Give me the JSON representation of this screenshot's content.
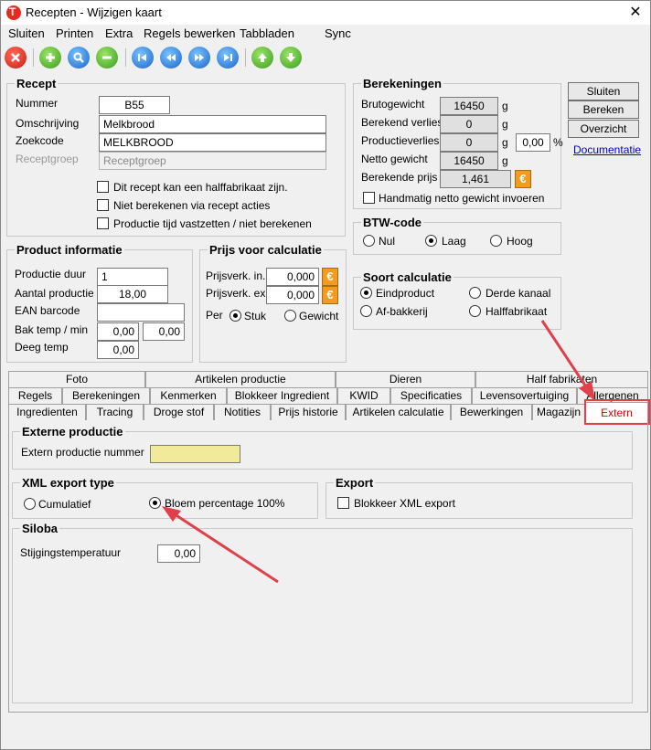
{
  "window": {
    "title": "Recepten - Wijzigen kaart",
    "close_glyph": "✕"
  },
  "menu": [
    "Sluiten",
    "Printen",
    "Extra",
    "Regels bewerken",
    "Tabbladen",
    "Sync"
  ],
  "toolbar": {
    "icons": [
      "close-icon",
      "add-icon",
      "search-icon",
      "remove-icon",
      "first-icon",
      "prev-icon",
      "next-icon",
      "last-icon",
      "up-icon",
      "down-icon"
    ]
  },
  "recept": {
    "title": "Recept",
    "nummer_label": "Nummer",
    "nummer_value": "B55",
    "omschrijving_label": "Omschrijving",
    "omschrijving_value": "Melkbrood",
    "zoekcode_label": "Zoekcode",
    "zoekcode_value": "MELKBROOD",
    "receptgroep_label": "Receptgroep",
    "receptgroep_value": "Receptgroep",
    "chk1": "Dit recept kan een halffabrikaat zijn.",
    "chk2": "Niet berekenen via recept acties",
    "chk3": "Productie tijd vastzetten / niet berekenen"
  },
  "berekeningen": {
    "title": "Berekeningen",
    "brutogewicht_label": "Brutogewicht",
    "brutogewicht_value": "16450",
    "berekend_verlies_label": "Berekend verlies",
    "berekend_verlies_value": "0",
    "productieverlies_label": "Productieverlies",
    "productieverlies_value": "0",
    "productieverlies_pct": "0,00",
    "netto_label": "Netto gewicht",
    "netto_value": "16450",
    "prijs_label": "Berekende prijs",
    "prijs_value": "1,461",
    "unit_g": "g",
    "unit_pct": "%",
    "handmatig": "Handmatig netto gewicht invoeren",
    "euro": "€"
  },
  "buttons": {
    "sluiten": "Sluiten",
    "bereken": "Bereken",
    "overzicht": "Overzicht",
    "documentatie": "Documentatie"
  },
  "btw": {
    "title": "BTW-code",
    "options": [
      "Nul",
      "Laag",
      "Hoog"
    ],
    "selected": "Laag"
  },
  "soort": {
    "title": "Soort calculatie",
    "options": [
      "Eindproduct",
      "Derde kanaal",
      "Af-bakkerij",
      "Halffabrikaat"
    ],
    "selected": "Eindproduct"
  },
  "product": {
    "title": "Product informatie",
    "duur_label": "Productie duur",
    "duur_value": "1",
    "aantal_label": "Aantal productie",
    "aantal_value": "18,00",
    "ean_label": "EAN barcode",
    "ean_value": "",
    "bak_label": "Bak temp / min",
    "bak_temp": "0,00",
    "bak_min": "0,00",
    "deeg_label": "Deeg temp",
    "deeg_value": "0,00"
  },
  "prijs": {
    "title": "Prijs voor calculatie",
    "in_label": "Prijsverk. in.",
    "in_value": "0,000",
    "ex_label": "Prijsverk. ex.",
    "ex_value": "0,000",
    "per_label": "Per",
    "options": [
      "Stuk",
      "Gewicht"
    ],
    "selected": "Stuk"
  },
  "tabs": {
    "row1": [
      "Foto",
      "Artikelen productie",
      "Dieren",
      "Half fabrikaten"
    ],
    "row2": [
      "Regels",
      "Berekeningen",
      "Kenmerken",
      "Blokkeer Ingredient",
      "KWID",
      "Specificaties",
      "Levensovertuiging",
      "Allergenen"
    ],
    "row3": [
      "Ingredienten",
      "Tracing",
      "Droge stof",
      "Notities",
      "Prijs historie",
      "Artikelen calculatie",
      "Bewerkingen",
      "Magazijn",
      "Extern"
    ],
    "active": "Extern"
  },
  "extern": {
    "externe_title": "Externe productie",
    "externe_label": "Extern productie nummer",
    "externe_value": "",
    "xml_title": "XML export type",
    "xml_options": [
      "Cumulatief",
      "Bloem percentage 100%"
    ],
    "xml_selected": "Bloem percentage 100%",
    "export_title": "Export",
    "export_chk": "Blokkeer XML export",
    "siloba_title": "Siloba",
    "stijging_label": "Stijgingstemperatuur",
    "stijging_value": "0,00"
  },
  "annotation_color": "#e0404a"
}
